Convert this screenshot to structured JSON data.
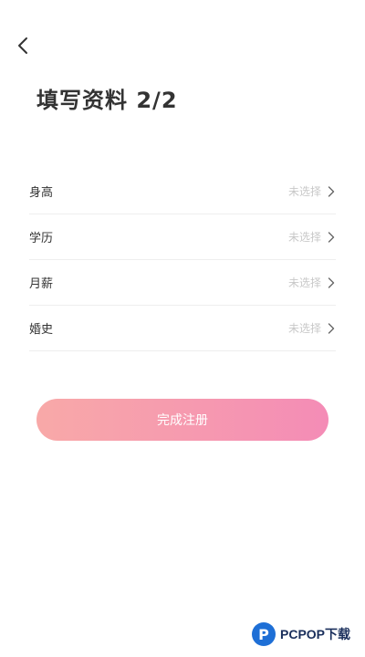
{
  "header": {
    "back_icon": "chevron-left-icon",
    "title": "填写资料 2/2"
  },
  "form": {
    "rows": [
      {
        "label": "身高",
        "value": "未选择",
        "icon": "chevron-right-icon"
      },
      {
        "label": "学历",
        "value": "未选择",
        "icon": "chevron-right-icon"
      },
      {
        "label": "月薪",
        "value": "未选择",
        "icon": "chevron-right-icon"
      },
      {
        "label": "婚史",
        "value": "未选择",
        "icon": "chevron-right-icon"
      }
    ]
  },
  "submit": {
    "label": "完成注册",
    "gradient_start": "#f8a9a8",
    "gradient_end": "#f48cb6"
  },
  "watermark": {
    "logo_letter": "P",
    "text": "PCPOP下载"
  }
}
